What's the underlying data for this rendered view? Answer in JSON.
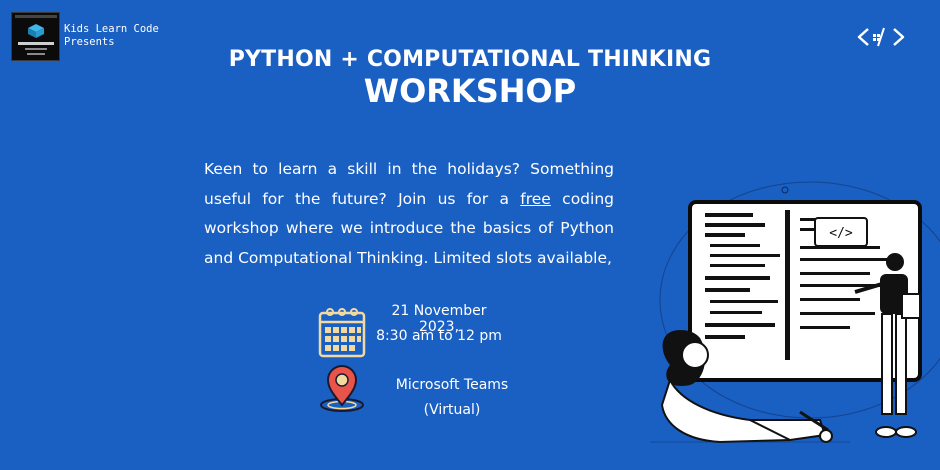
{
  "presenter": {
    "line1": "Kids Learn Code",
    "line2": "Presents"
  },
  "title": {
    "line1": "PYTHON + COMPUTATIONAL THINKING",
    "line2": "WORKSHOP"
  },
  "description": {
    "before": "Keen to learn a skill in the holidays? Something useful for the future? Join us for a ",
    "emphasis": "free",
    "after": " coding workshop where we introduce the basics of Python and Computational Thinking. Limited slots available,"
  },
  "event": {
    "date": "21 November 2023,",
    "time": "8:30 am to 12 pm"
  },
  "location": {
    "line1": "Microsoft Teams",
    "line2": "(Virtual)"
  },
  "illustration": {
    "code_tag": "</>"
  },
  "colors": {
    "background": "#1a5fc2",
    "icon_accent": "#f2d9a0",
    "pin_red": "#e8534a"
  }
}
